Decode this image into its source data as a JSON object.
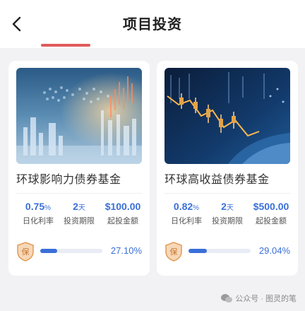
{
  "header": {
    "title": "项目投资"
  },
  "products": [
    {
      "name": "环球影响力债券基金",
      "rate": "0.75",
      "rate_unit": "%",
      "rate_label": "日化利率",
      "term": "2",
      "term_unit": "天",
      "term_label": "投资期限",
      "min_amount": "$100.00",
      "min_label": "起投金额",
      "progress_text": "27.10%",
      "progress": 0.271
    },
    {
      "name": "环球高收益债券基金",
      "rate": "0.82",
      "rate_unit": "%",
      "rate_label": "日化利率",
      "term": "2",
      "term_unit": "天",
      "term_label": "投资期限",
      "min_amount": "$500.00",
      "min_label": "起投金额",
      "progress_text": "29.04%",
      "progress": 0.2904
    }
  ],
  "badge_char": "保",
  "watermark": "公众号 · 图灵的笔",
  "colors": {
    "accent": "#3a6fd8",
    "indicator": "#e15b5b",
    "badge": "#e49b55"
  }
}
